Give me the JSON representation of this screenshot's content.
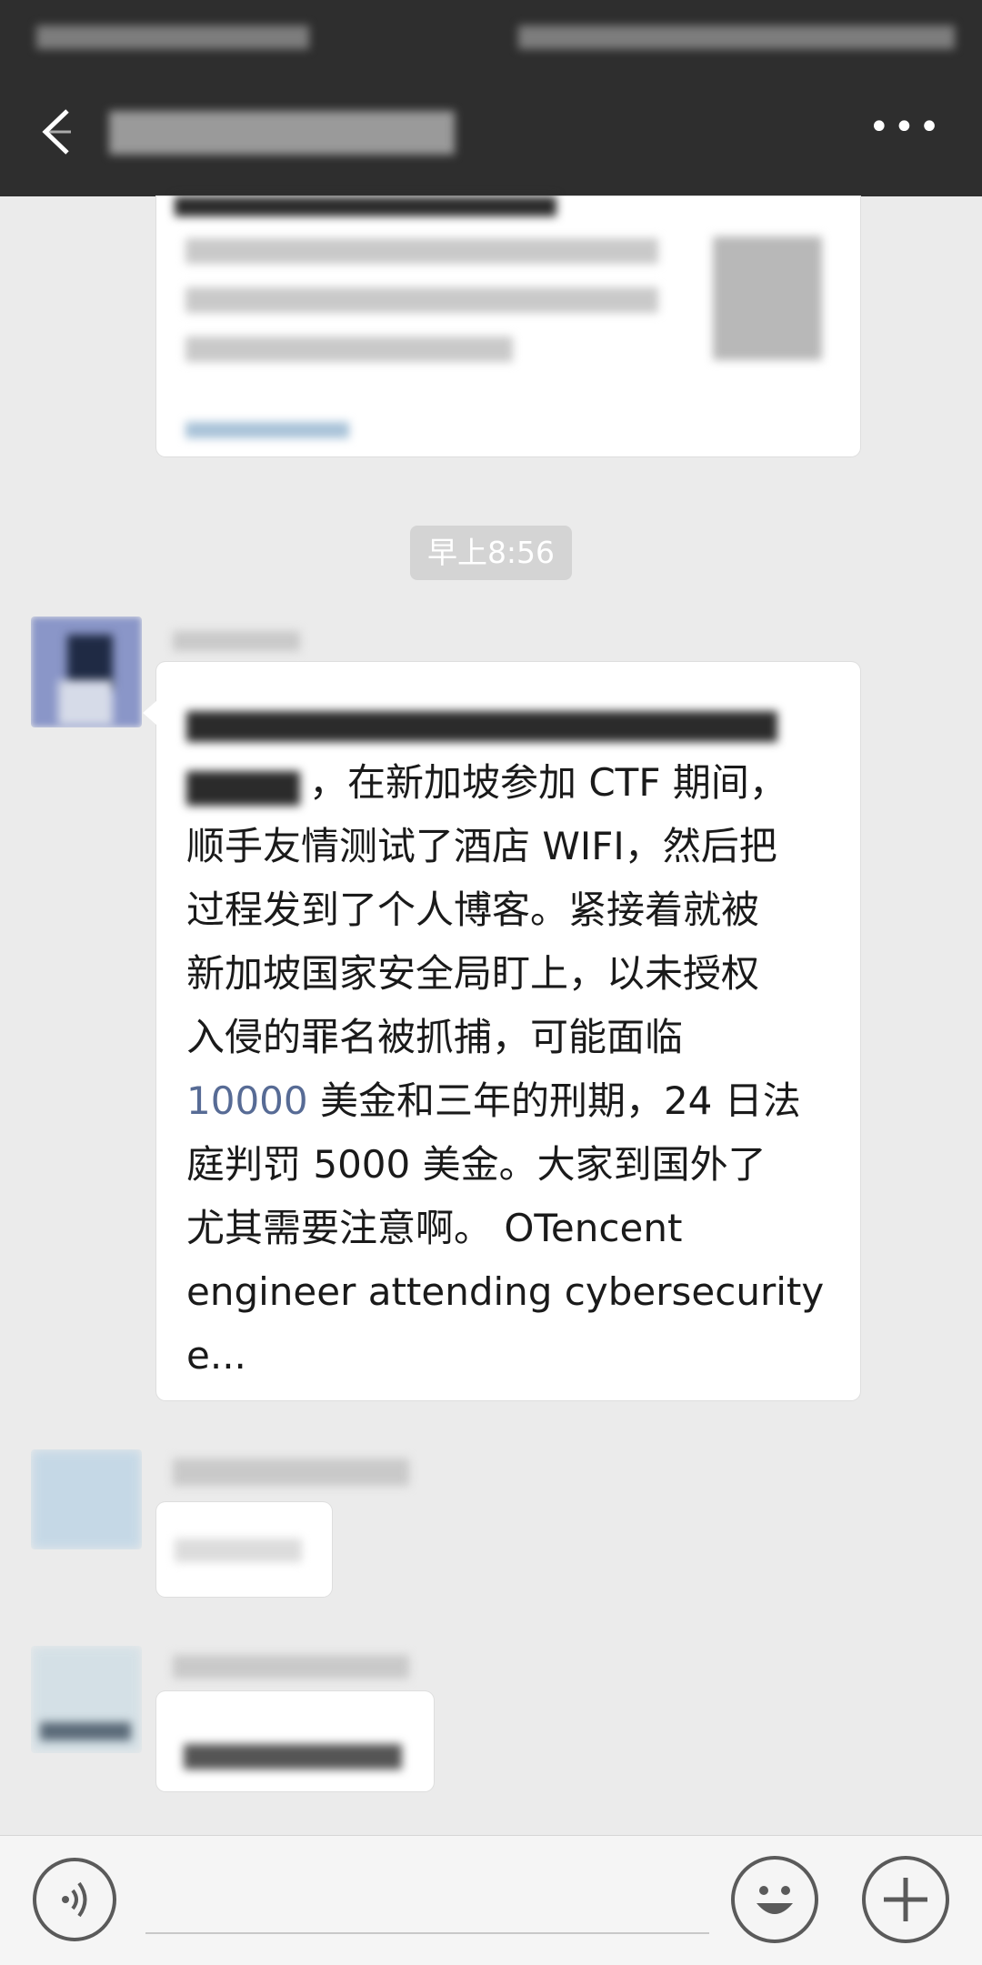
{
  "header": {
    "back_icon": "chevron-left-icon",
    "more_label": "•••"
  },
  "chat": {
    "timestamp": "早上8:56",
    "news_message": {
      "line2_suffix": "，在新加坡参加 CTF 期间，",
      "line3": "顺手友情测试了酒店 WIFI，然后把",
      "line4": "过程发到了个人博客。紧接着就被",
      "line5": "新加坡国家安全局盯上，以未授权",
      "line6": "入侵的罪名被抓捕，可能面临",
      "line7_link": "10000",
      "line7_rest": " 美金和三年的刑期，24 日法",
      "line8": "庭判罚 5000 美金。大家到国外了",
      "line9": "尤其需要注意啊。 OTencent",
      "line10": "engineer attending cybersecurity",
      "line11": "e..."
    }
  },
  "input_bar": {
    "voice_icon": "voice-icon",
    "emoji_icon": "emoji-icon",
    "plus_icon": "plus-icon"
  },
  "colors": {
    "header_bg": "#2e2e2e",
    "chat_bg": "#ebebeb",
    "link": "#576b95"
  }
}
